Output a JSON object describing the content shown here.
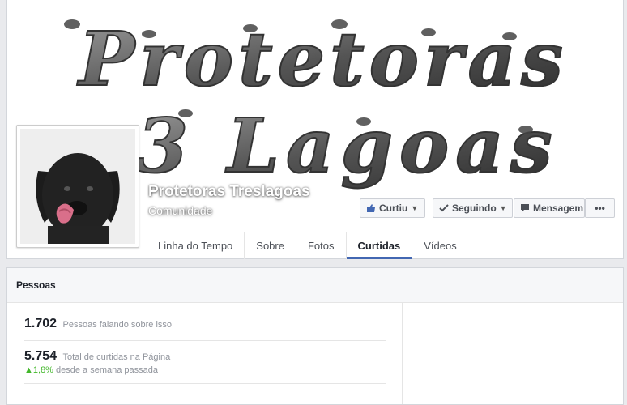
{
  "page": {
    "name": "Protetoras Treslagoas",
    "category": "Comunidade",
    "cover_title_line1": "Protetoras",
    "cover_title_line2": "3 Lagoas"
  },
  "actions": {
    "like_label": "Curtiu",
    "following_label": "Seguindo",
    "message_label": "Mensagem",
    "more_label": "•••"
  },
  "tabs": [
    {
      "label": "Linha do Tempo",
      "active": false
    },
    {
      "label": "Sobre",
      "active": false
    },
    {
      "label": "Fotos",
      "active": false
    },
    {
      "label": "Curtidas",
      "active": true
    },
    {
      "label": "Vídeos",
      "active": false
    }
  ],
  "people": {
    "heading": "Pessoas",
    "talking_count": "1.702",
    "talking_label": "Pessoas falando sobre isso",
    "likes_count": "5.754",
    "likes_label": "Total de curtidas na Página",
    "growth_value": "1,8%",
    "growth_label": "desde a semana passada"
  },
  "colors": {
    "brand": "#4267b2",
    "growth": "#42b72a",
    "background": "#e9eaed"
  }
}
